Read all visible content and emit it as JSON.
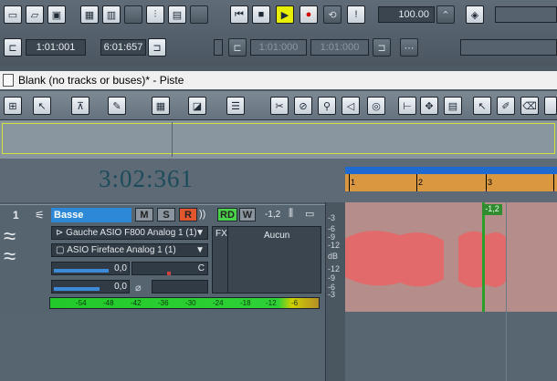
{
  "toolbar": {
    "tempo": "100.00",
    "now_time": "1:01:001",
    "end_time": "6:01:657",
    "loop_start": "1:01:000",
    "loop_end": "1:01:000"
  },
  "window": {
    "title": "Blank (no tracks or buses)* - Piste"
  },
  "time_display": "3:02:361",
  "ruler": {
    "ticks": [
      "1",
      "2",
      "3"
    ]
  },
  "track": {
    "number": "1",
    "name": "Basse",
    "mute": "M",
    "solo": "S",
    "record": "R",
    "read": "RD",
    "write": "W",
    "peak": "-1,2",
    "input": "Gauche ASIO F800 Analog 1 (1)",
    "output": "ASIO Fireface Analog 1 (1)",
    "volume": "0,0",
    "pan": "C",
    "send": "0,0",
    "fx_label": "FX",
    "fx_value": "Aucun",
    "meter_ticks": [
      "-54",
      "-48",
      "-42",
      "-36",
      "-30",
      "-24",
      "-18",
      "-12",
      "-6"
    ]
  },
  "clip": {
    "marker": "-1,2"
  },
  "scale_labels": [
    "-3",
    "-6",
    "-9",
    "-12",
    "dB",
    "-12",
    "-9",
    "-6",
    "-3"
  ]
}
